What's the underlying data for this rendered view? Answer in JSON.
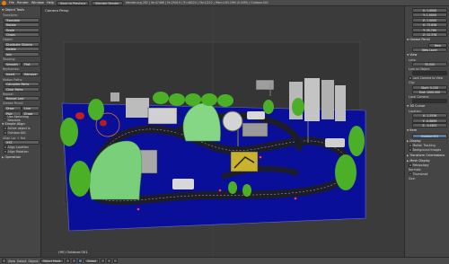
{
  "topbar": {
    "menus": [
      "File",
      "Render",
      "Window",
      "Help"
    ],
    "back_button": "Back to Previous",
    "render_engine": "Blender Render",
    "stats": "blender.org 262 | Ve:47466 | Fa:29419 | Tri:48224 | Ob:1/222 | Mem:163.29M (0.00M) | Outdoor.001"
  },
  "toolshelf": {
    "object_tools_header": "Object Tools",
    "transform_label": "Transform:",
    "transform_buttons": [
      "Translate",
      "Rotate",
      "Scale",
      "Origin"
    ],
    "object_label": "Object:",
    "object_buttons": [
      "Duplicate Objects",
      "Delete",
      "Join"
    ],
    "shading_label": "Shading:",
    "shading_row": [
      "Smooth",
      "Flat"
    ],
    "keyframes_label": "Keyframes:",
    "keyframes_row": [
      "Insert",
      "Remove"
    ],
    "motion_paths_label": "Motion Paths:",
    "motion_paths_buttons": [
      "Calculate Paths",
      "Clear Paths"
    ],
    "repeat_label": "Repeat:",
    "repeat_buttons": [
      "Repeat Last"
    ],
    "grease_pencil_label": "Grease Pencil:",
    "grease_row1": [
      "Draw",
      "Line"
    ],
    "grease_row2": [
      "Poly",
      "Erase"
    ],
    "grease_check": "Use Sketching Sessions",
    "simple_align_header": "Simple Align",
    "align_check1": "Active object is",
    "align_check2": "Outdoor.001",
    "align_x_label": "Align Loc + Rot",
    "align_axes": [
      "XYZ"
    ],
    "align_loc": "Align Location",
    "align_rot": "Align Rotation",
    "operation_header": "Operation"
  },
  "viewport": {
    "label": "Camera Persp",
    "footer_label": "(90) Outdoor.001"
  },
  "props": {
    "fields_top": [
      "X: 1.0000",
      "Y: 1.0000",
      "Z: 1.0000"
    ],
    "dimensions": [
      "X: 73.838",
      "Y: 55.760",
      "Z: 12.378"
    ],
    "grease_header": "Grease Pencil",
    "grease_new": "New",
    "grease_new_layer": "New Layer",
    "view_header": "View",
    "lens_label": "Lens:",
    "lens_value": "35.000",
    "lock_label": "Lock to Object:",
    "lock_cursor": "Lock Camera to View",
    "clip_label": "Clip:",
    "clip_start": "Start: 0.100",
    "clip_end": "End: 1000.000",
    "local_cam_label": "Local Camera:",
    "cursor_header": "3D Cursor",
    "location_label": "Location:",
    "cursor_xyz": [
      "X: 1.2536",
      "Y: -0.6899",
      "Z: -0.4821"
    ],
    "item_header": "Item",
    "item_name": "Outdoor.001",
    "display_header": "Display",
    "motion_tracking": "Motion Tracking",
    "background_images": "Background Images",
    "transform_orient": "Transform Orientations",
    "mesh_display": "Mesh Display",
    "retopo_label": "Retopology",
    "normals_label": "Normals:",
    "thumbnail_label": "Thumbnail",
    "size_label": "Size:"
  },
  "bottombar": {
    "view": "View",
    "select": "Select",
    "object": "Object",
    "mode": "Object Mode",
    "pivot": "Global",
    "layer_hint": "Layers"
  },
  "colors": {
    "ground_blue": "#0a0f9a",
    "road": "#2a2a2a",
    "tree_green": "#4caf28",
    "tunnel_green": "#7ad07a",
    "accent_orange": "#e87d0d",
    "selection_blue": "#5a7aa6"
  }
}
